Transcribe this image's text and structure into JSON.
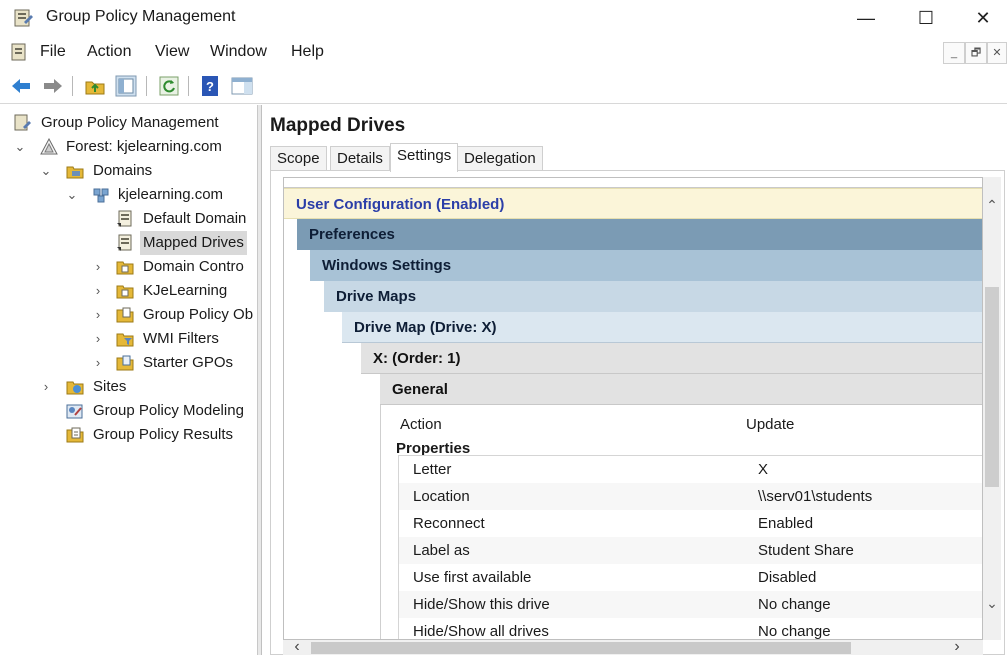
{
  "window": {
    "title": "Group Policy Management",
    "minimize": "—",
    "maximize": "☐",
    "close": "✕"
  },
  "menu": {
    "items": [
      "File",
      "Action",
      "View",
      "Window",
      "Help"
    ],
    "mdi_minimize": "_",
    "mdi_restore": "🗗",
    "mdi_close": "✕"
  },
  "tree": {
    "root": "Group Policy Management",
    "forest": "Forest: kjelearning.com",
    "domains": "Domains",
    "domain": "kjelearning.com",
    "items": [
      "Default Domain",
      "Mapped Drives",
      "Domain Contro",
      "KJeLearning",
      "Group Policy Ob",
      "WMI Filters",
      "Starter GPOs"
    ],
    "sites": "Sites",
    "modeling": "Group Policy Modeling",
    "results": "Group Policy Results"
  },
  "right": {
    "title": "Mapped Drives",
    "tabs": [
      "Scope",
      "Details",
      "Settings",
      "Delegation"
    ],
    "active_tab": "Settings"
  },
  "report": {
    "user_config": "User Configuration (Enabled)",
    "preferences": "Preferences",
    "windows_settings": "Windows Settings",
    "drive_maps": "Drive Maps",
    "drive_map": "Drive Map (Drive: X)",
    "order": "X: (Order: 1)",
    "general": "General",
    "action_label": "Action",
    "action_value": "Update",
    "properties_label": "Properties",
    "properties": [
      {
        "key": "Letter",
        "value": "X"
      },
      {
        "key": "Location",
        "value": "\\\\serv01\\students"
      },
      {
        "key": "Reconnect",
        "value": "Enabled"
      },
      {
        "key": "Label as",
        "value": "Student Share"
      },
      {
        "key": "Use first available",
        "value": "Disabled"
      },
      {
        "key": "Hide/Show this drive",
        "value": "No change"
      },
      {
        "key": "Hide/Show all drives",
        "value": "No change"
      }
    ]
  },
  "colors": {
    "user_config_bg": "#fbf5d9",
    "user_config_text": "#2b3ea8",
    "preferences_bg": "#7b9bb4",
    "windows_settings_bg": "#a8c2d6",
    "drive_maps_bg": "#c7d8e5",
    "drive_map_bg": "#dbe7f0"
  }
}
